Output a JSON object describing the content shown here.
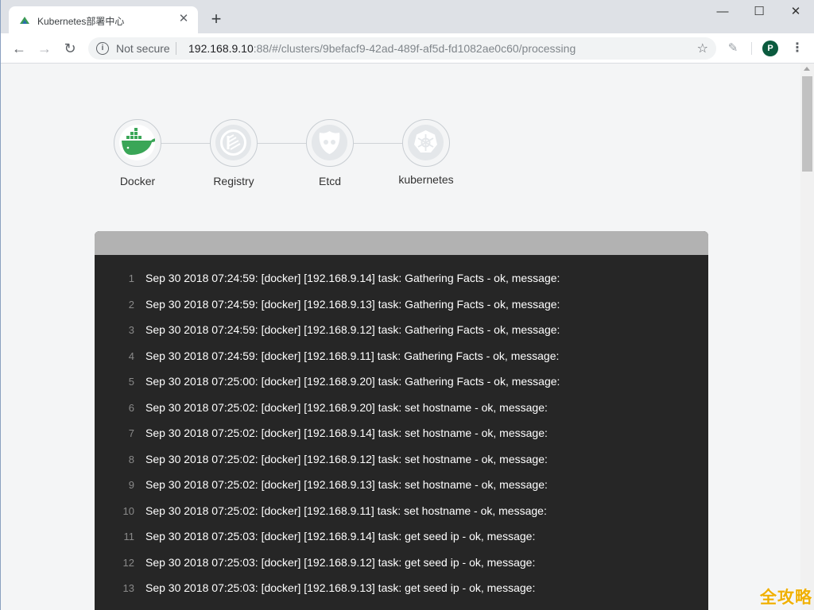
{
  "tab": {
    "title": "Kubernetes部署中心",
    "close": "✕"
  },
  "window": {
    "minimize": "—",
    "maximize": "☐",
    "close": "✕"
  },
  "new_tab": "+",
  "toolbar": {
    "back": "←",
    "forward": "→",
    "reload": "↻",
    "star": "☆",
    "menu": "⋮"
  },
  "omnibox": {
    "security": "Not secure",
    "url_host": "192.168.9.10",
    "url_rest": ":88/#/clusters/9befacf9-42ad-489f-af5d-fd1082ae0c60/processing"
  },
  "profile": {
    "initial": "P",
    "color": "#0b5a3e"
  },
  "steps": [
    {
      "label": "Docker",
      "icon": "docker-whale-icon",
      "active": true
    },
    {
      "label": "Registry",
      "icon": "registry-icon",
      "active": false
    },
    {
      "label": "Etcd",
      "icon": "etcd-icon",
      "active": false
    },
    {
      "label": "kubernetes",
      "icon": "kubernetes-helm-icon",
      "active": false
    }
  ],
  "log": {
    "lines": [
      {
        "n": "1",
        "text": "Sep 30 2018 07:24:59: [docker] [192.168.9.14] task: Gathering Facts - ok, message:"
      },
      {
        "n": "2",
        "text": "Sep 30 2018 07:24:59: [docker] [192.168.9.13] task: Gathering Facts - ok, message:"
      },
      {
        "n": "3",
        "text": "Sep 30 2018 07:24:59: [docker] [192.168.9.12] task: Gathering Facts - ok, message:"
      },
      {
        "n": "4",
        "text": "Sep 30 2018 07:24:59: [docker] [192.168.9.11] task: Gathering Facts - ok, message:"
      },
      {
        "n": "5",
        "text": "Sep 30 2018 07:25:00: [docker] [192.168.9.20] task: Gathering Facts - ok, message:"
      },
      {
        "n": "6",
        "text": "Sep 30 2018 07:25:02: [docker] [192.168.9.20] task: set hostname - ok, message:"
      },
      {
        "n": "7",
        "text": "Sep 30 2018 07:25:02: [docker] [192.168.9.14] task: set hostname - ok, message:"
      },
      {
        "n": "8",
        "text": "Sep 30 2018 07:25:02: [docker] [192.168.9.12] task: set hostname - ok, message:"
      },
      {
        "n": "9",
        "text": "Sep 30 2018 07:25:02: [docker] [192.168.9.13] task: set hostname - ok, message:"
      },
      {
        "n": "10",
        "text": "Sep 30 2018 07:25:02: [docker] [192.168.9.11] task: set hostname - ok, message:"
      },
      {
        "n": "11",
        "text": "Sep 30 2018 07:25:03: [docker] [192.168.9.14] task: get seed ip - ok, message:"
      },
      {
        "n": "12",
        "text": "Sep 30 2018 07:25:03: [docker] [192.168.9.12] task: get seed ip - ok, message:"
      },
      {
        "n": "13",
        "text": "Sep 30 2018 07:25:03: [docker] [192.168.9.13] task: get seed ip - ok, message:"
      }
    ]
  },
  "watermark": "全攻略"
}
